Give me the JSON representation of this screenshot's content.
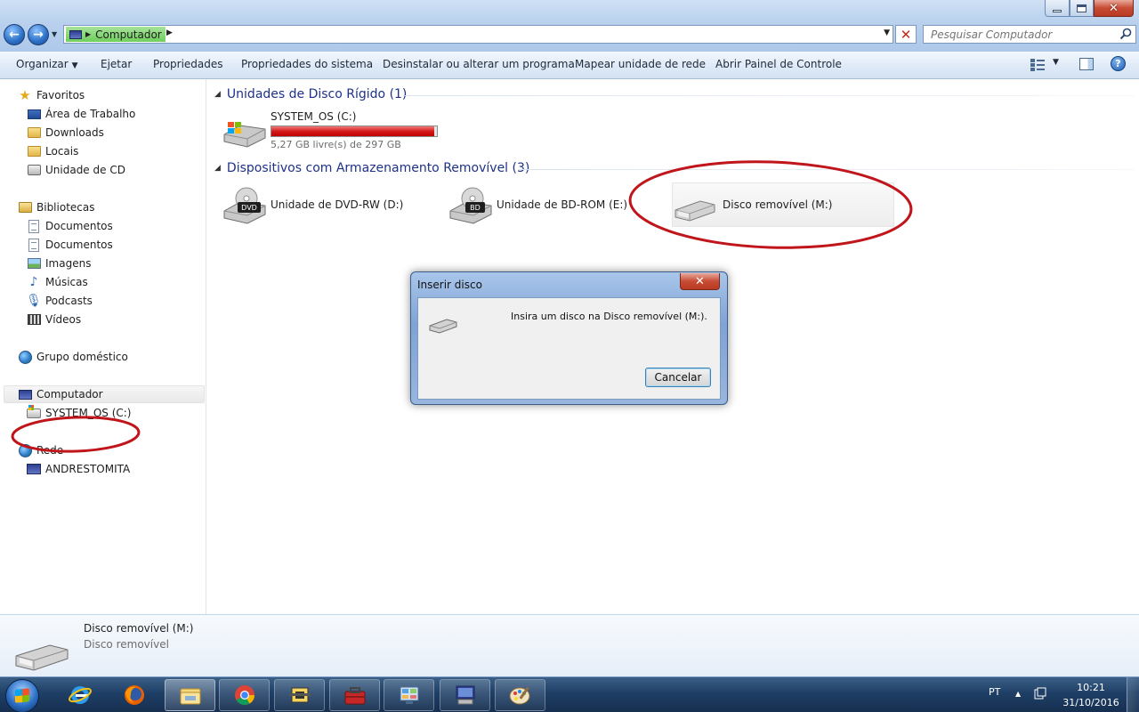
{
  "window": {
    "controls": {
      "minimize": "minimize-icon",
      "maximize": "maximize-icon",
      "close": "close-icon"
    }
  },
  "address_bar": {
    "path_segment": "Computador",
    "search_placeholder": "Pesquisar Computador"
  },
  "toolbar": {
    "organize": "Organizar",
    "eject": "Ejetar",
    "properties": "Propriedades",
    "system_properties": "Propriedades do sistema",
    "uninstall": "Desinstalar ou alterar um programa",
    "map_drive": "Mapear unidade de rede",
    "control_panel": "Abrir Painel de Controle"
  },
  "sidebar": {
    "favorites": {
      "label": "Favoritos",
      "items": [
        "Área de Trabalho",
        "Downloads",
        "Locais",
        "Unidade de CD"
      ]
    },
    "libraries": {
      "label": "Bibliotecas",
      "items": [
        "Documentos",
        "Documentos",
        "Imagens",
        "Músicas",
        "Podcasts",
        "Vídeos"
      ]
    },
    "homegroup": "Grupo doméstico",
    "computer": {
      "label": "Computador",
      "items": [
        "SYSTEM_OS (C:)"
      ]
    },
    "network": {
      "label": "Rede",
      "items": [
        "ANDRESTOMITA"
      ]
    }
  },
  "content": {
    "hard_disks": {
      "header": "Unidades de Disco Rígido (1)",
      "drives": [
        {
          "name": "SYSTEM_OS (C:)",
          "free_text": "5,27 GB livre(s) de 297 GB",
          "used_fraction": 0.982
        }
      ]
    },
    "removable": {
      "header": "Dispositivos com Armazenamento Removível (3)",
      "devices": [
        {
          "name": "Unidade de DVD-RW (D:)",
          "badge": "DVD"
        },
        {
          "name": "Unidade de BD-ROM (E:)",
          "badge": "BD"
        },
        {
          "name": "Disco removível (M:)"
        }
      ]
    }
  },
  "dialog": {
    "title": "Inserir disco",
    "message": "Insira um disco na Disco removível (M:).",
    "cancel": "Cancelar"
  },
  "details": {
    "name": "Disco removível (M:)",
    "type": "Disco removível"
  },
  "taskbar": {
    "language": "PT",
    "time": "10:21",
    "date": "31/10/2016",
    "apps": [
      "internet-explorer-icon",
      "firefox-icon",
      "file-explorer-icon",
      "chrome-icon",
      "app-icon",
      "toolbox-icon",
      "control-panel-icon",
      "computer-icon",
      "paint-icon"
    ]
  },
  "colors": {
    "annotation": "#c0151b",
    "capacity_bar": "#d41a1a",
    "group_header": "#1e3287"
  }
}
